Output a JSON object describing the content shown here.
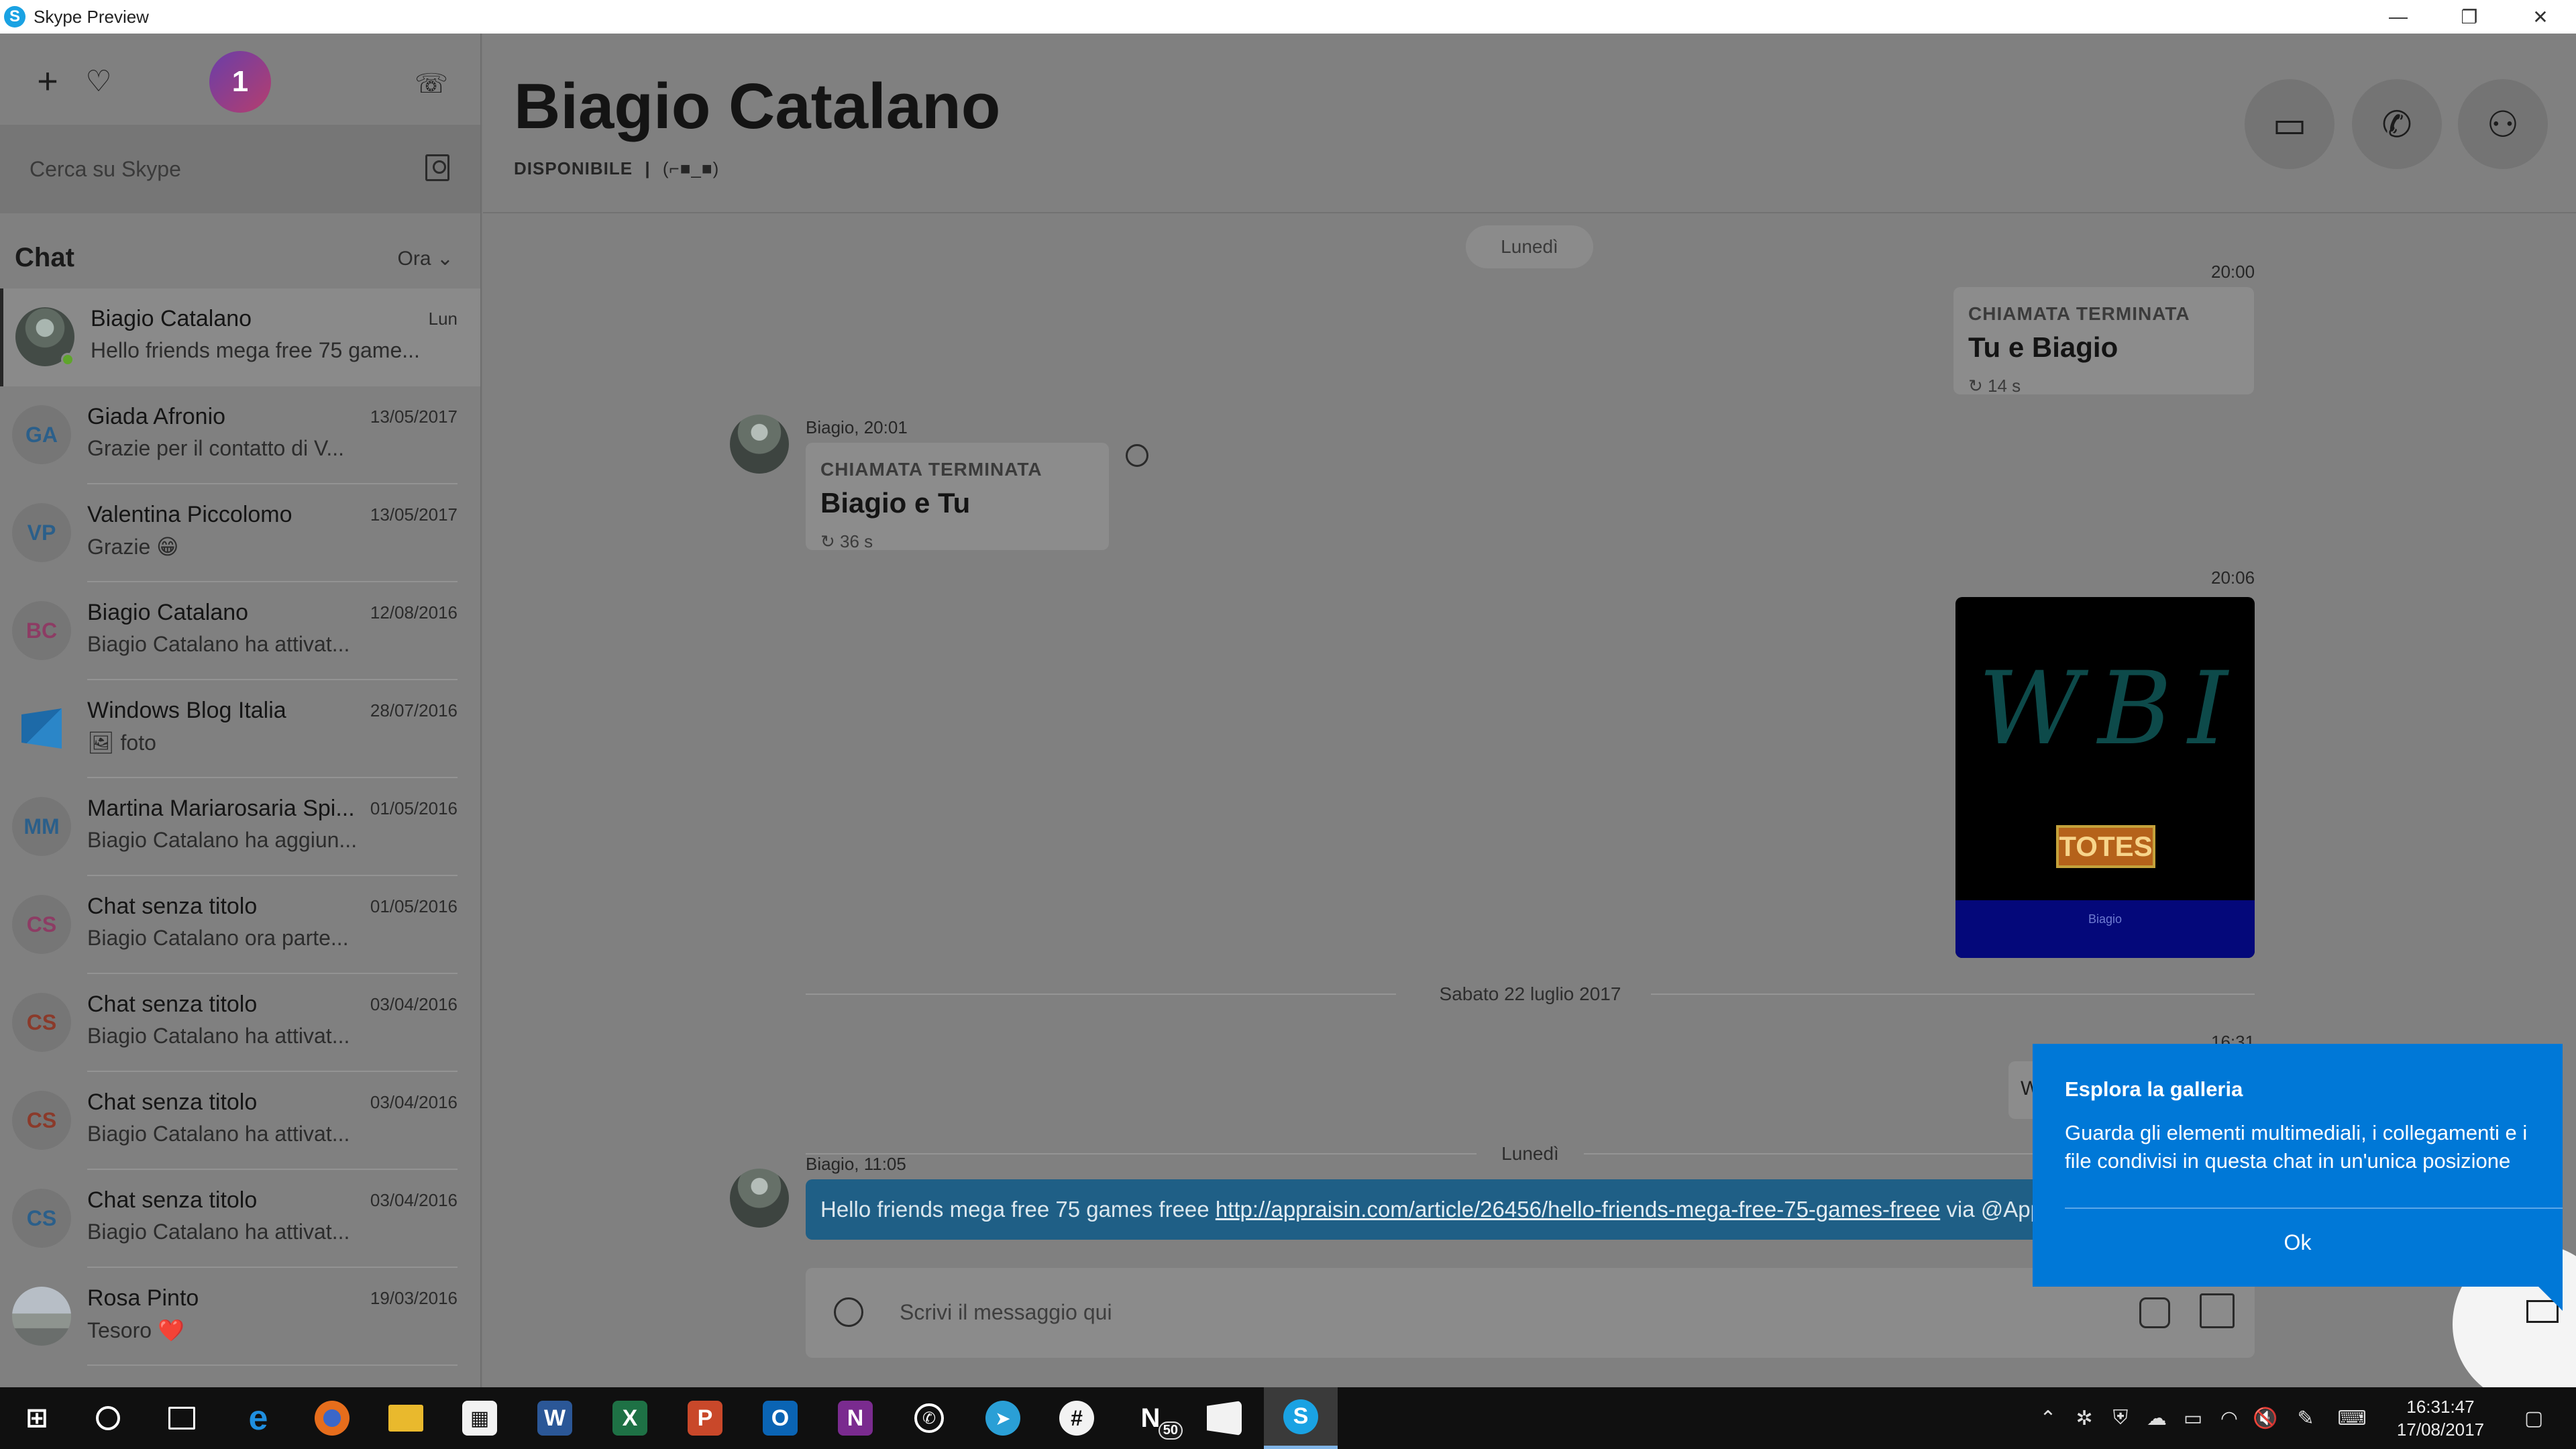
{
  "window": {
    "title": "Skype Preview",
    "minimize": "—",
    "restore": "❐",
    "close": "✕"
  },
  "sidebar": {
    "new_chat_icon": "plus-icon",
    "favorites_icon": "heart-icon",
    "profile_badge": "1",
    "call_history_icon": "call-history-icon",
    "search_placeholder": "Cerca su Skype",
    "chat_section_title": "Chat",
    "sort_label": "Ora",
    "chats": [
      {
        "name": "Biagio Catalano",
        "date": "Lun",
        "preview": "Hello friends mega free 75 game...",
        "initials": "",
        "active": true
      },
      {
        "name": "Giada Afronio",
        "date": "13/05/2017",
        "preview": "Grazie per il contatto di V...",
        "initials": "GA"
      },
      {
        "name": "Valentina Piccolomo",
        "date": "13/05/2017",
        "preview": "Grazie 😁",
        "initials": "VP"
      },
      {
        "name": "Biagio Catalano",
        "date": "12/08/2016",
        "preview": "Biagio Catalano ha attivat...",
        "initials": "BC"
      },
      {
        "name": "Windows Blog Italia",
        "date": "28/07/2016",
        "preview": "🖼 foto",
        "initials": ""
      },
      {
        "name": "Martina Mariarosaria Spi...",
        "date": "01/05/2016",
        "preview": "Biagio Catalano ha aggiun...",
        "initials": "MM"
      },
      {
        "name": "Chat senza titolo",
        "date": "01/05/2016",
        "preview": "Biagio Catalano ora parte...",
        "initials": "CS"
      },
      {
        "name": "Chat senza titolo",
        "date": "03/04/2016",
        "preview": "Biagio Catalano ha attivat...",
        "initials": "CS"
      },
      {
        "name": "Chat senza titolo",
        "date": "03/04/2016",
        "preview": "Biagio Catalano ha attivat...",
        "initials": "CS"
      },
      {
        "name": "Chat senza titolo",
        "date": "03/04/2016",
        "preview": "Biagio Catalano ha attivat...",
        "initials": "CS"
      },
      {
        "name": "Rosa Pinto",
        "date": "19/03/2016",
        "preview": "Tesoro ❤️",
        "initials": ""
      }
    ]
  },
  "conversation": {
    "contact_name": "Biagio Catalano",
    "status": "DISPONIBILE",
    "status_sep": "|",
    "mood": "(⌐■_■)",
    "actions": {
      "video_icon": "video-call-icon",
      "call_icon": "phone-icon",
      "add_icon": "add-person-icon"
    },
    "day_pill": "Lunedì",
    "call_out": {
      "time": "20:00",
      "kicker": "CHIAMATA TERMINATA",
      "title": "Tu e Biagio",
      "duration": "↻ 14 s"
    },
    "call_in": {
      "sender": "Biagio, 20:01",
      "kicker": "CHIAMATA TERMINATA",
      "title": "Biagio e Tu",
      "duration": "↻ 36 s"
    },
    "image_msg": {
      "time": "20:06",
      "scribble": "WBI",
      "sticker": "TOTES",
      "caption": "Biagio"
    },
    "date_sep_1": "Sabato 22 luglio 2017",
    "partial_msg": {
      "time": "16:31",
      "text": "W"
    },
    "date_sep_2": "Lunedì",
    "link_msg": {
      "sender": "Biagio, 11:05",
      "text_before": "Hello friends mega free 75 games freee ",
      "link": "http://appraisin.com/article/26456/hello-friends-mega-free-75-games-freee",
      "text_after": " via @AppRaisinHQ"
    },
    "composer_placeholder": "Scrivi il messaggio qui"
  },
  "tooltip": {
    "title": "Esplora la galleria",
    "body": "Guarda gli elementi multimediali, i collegamenti e i file condivisi in questa chat in un'unica posizione",
    "ok": "Ok"
  },
  "taskbar": {
    "apps": [
      "start",
      "cortana",
      "task-view",
      "edge",
      "firefox",
      "file-explorer",
      "store",
      "word",
      "excel",
      "powerpoint",
      "outlook",
      "onenote",
      "whatsapp",
      "telegram",
      "slack",
      "news",
      "windows-blog",
      "skype"
    ],
    "news_badge": "50",
    "clock_time": "16:31:47",
    "clock_date": "17/08/2017"
  },
  "colors": {
    "accent": "#0078d7",
    "link_bubble": "#1f5f86",
    "presence": "#5fa52c"
  }
}
